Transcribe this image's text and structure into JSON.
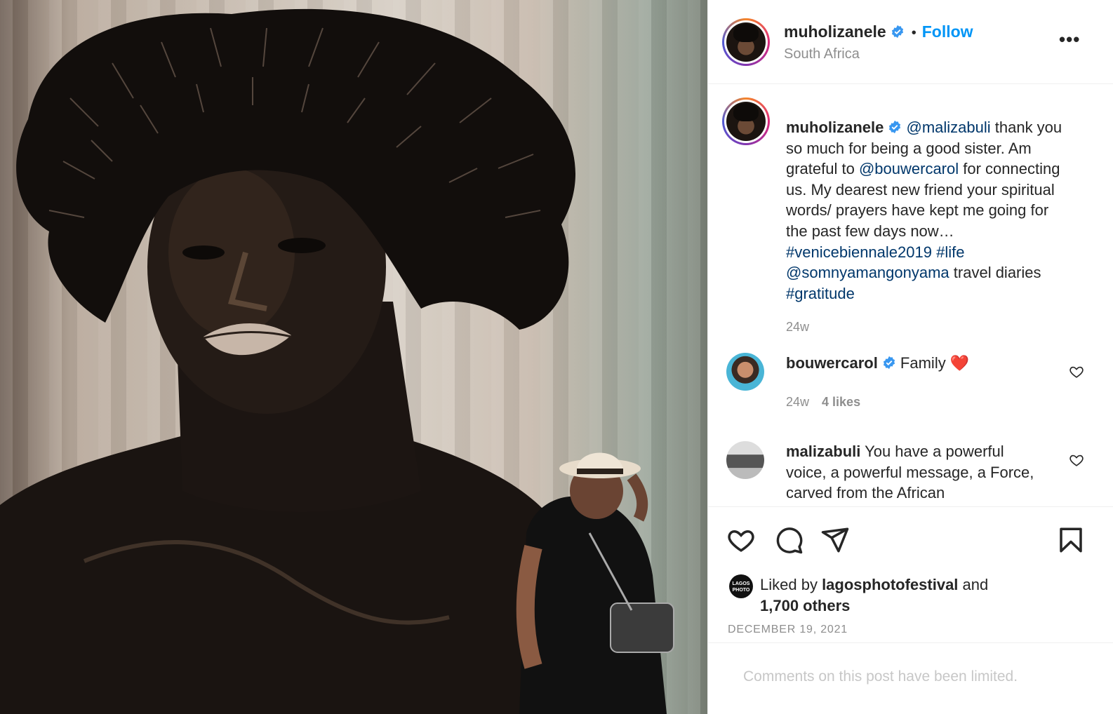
{
  "post": {
    "image_alt": "Large black-and-white portrait with a woman in a hat posing beside it",
    "author": {
      "username": "muholizanele",
      "verified": true,
      "location": "South Africa",
      "follow_label": "Follow"
    },
    "more_icon": "ellipsis-icon",
    "caption": {
      "username": "muholizanele",
      "parts": [
        {
          "text": "@malizabuli",
          "link": true
        },
        {
          "text": " thank you so much for being a good sister. Am grateful to ",
          "link": false
        },
        {
          "text": "@bouwercarol",
          "link": true
        },
        {
          "text": " for connecting us. My dearest new friend your spiritual words/ prayers have kept me going for the past few days now… ",
          "link": false
        },
        {
          "text": "#venicebiennale2019",
          "link": true
        },
        {
          "text": " ",
          "link": false
        },
        {
          "text": "#life",
          "link": true
        },
        {
          "text": " ",
          "link": false
        },
        {
          "text": "@somnyamangonyama",
          "link": true
        },
        {
          "text": " travel diaries ",
          "link": false
        },
        {
          "text": "#gratitude",
          "link": true
        }
      ],
      "time": "24w"
    },
    "comments": [
      {
        "username": "bouwercarol",
        "verified": true,
        "text": " Family ",
        "emoji": "❤️",
        "time": "24w",
        "likes": "4 likes"
      },
      {
        "username": "malizabuli",
        "verified": false,
        "text": " You have a powerful voice, a powerful message, a Force, carved from the African",
        "time": "",
        "likes": ""
      }
    ],
    "actions": {
      "like_icon": "heart-icon",
      "comment_icon": "comment-icon",
      "share_icon": "share-icon",
      "save_icon": "bookmark-icon"
    },
    "liked_by": {
      "prefix": "Liked by ",
      "user": "lagosphotofestival",
      "middle": " and",
      "others": "1,700 others",
      "avatar_text": "LAGOS PHOTO"
    },
    "date": "DECEMBER 19, 2021",
    "comments_limited": "Comments on this post have been limited."
  },
  "colors": {
    "link": "#00376b",
    "follow": "#0095f6",
    "muted": "#8e8e8e",
    "heart": "#ed4956",
    "verified": "#3897f0"
  }
}
